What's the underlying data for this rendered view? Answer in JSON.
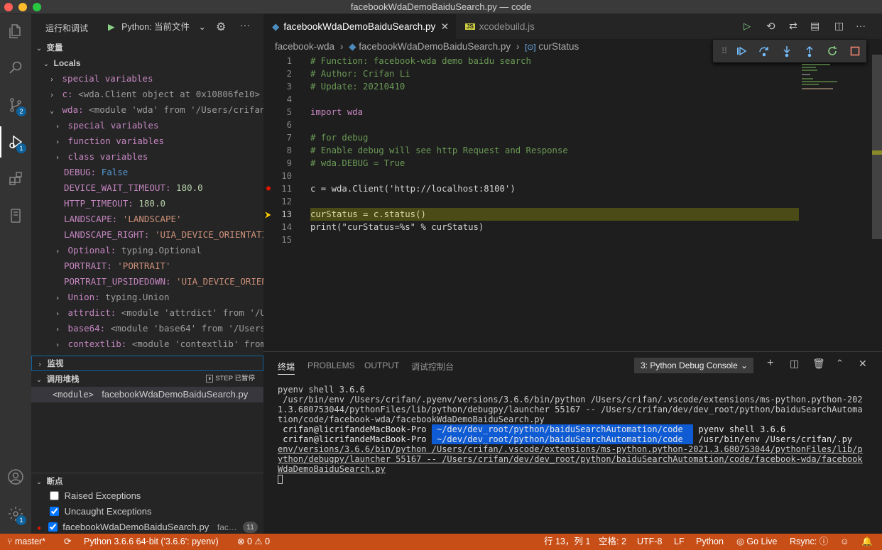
{
  "window": {
    "title": "facebookWdaDemoBaiduSearch.py — code"
  },
  "activity_bar": {
    "scm_badge": "2",
    "debug_badge": "1",
    "settings_badge": "1"
  },
  "sidebar": {
    "title": "运行和调试",
    "config": "Python: 当前文件",
    "sections": {
      "variables": "变量",
      "watch": "监视",
      "callstack": "调用堆栈",
      "breakpoints": "断点"
    },
    "locals_label": "Locals",
    "variables": [
      {
        "name": "special variables",
        "value": ""
      },
      {
        "name": "c:",
        "value": "<wda.Client object at 0x10806fe10>"
      },
      {
        "name": "wda:",
        "value": "<module 'wda' from '/Users/crifan/.py…"
      },
      {
        "name": "special variables",
        "value": ""
      },
      {
        "name": "function variables",
        "value": ""
      },
      {
        "name": "class variables",
        "value": ""
      },
      {
        "name": "DEBUG:",
        "value": "False"
      },
      {
        "name": "DEVICE_WAIT_TIMEOUT:",
        "value": "180.0"
      },
      {
        "name": "HTTP_TIMEOUT:",
        "value": "180.0"
      },
      {
        "name": "LANDSCAPE:",
        "value": "'LANDSCAPE'"
      },
      {
        "name": "LANDSCAPE_RIGHT:",
        "value": "'UIA_DEVICE_ORIENTATION_…"
      },
      {
        "name": "Optional:",
        "value": "typing.Optional"
      },
      {
        "name": "PORTRAIT:",
        "value": "'PORTRAIT'"
      },
      {
        "name": "PORTRAIT_UPSIDEDOWN:",
        "value": "'UIA_DEVICE_ORIENTAT…"
      },
      {
        "name": "Union:",
        "value": "typing.Union"
      },
      {
        "name": "attrdict:",
        "value": "<module 'attrdict' from '/Users…"
      },
      {
        "name": "base64:",
        "value": "<module 'base64' from '/Users/cri…"
      },
      {
        "name": "contextlib:",
        "value": "<module 'contextlib' from '/U…"
      }
    ],
    "callstack_status": "STEP 已暂停",
    "frame": {
      "name": "<module>",
      "file": "facebookWdaDemoBaiduSearch.py"
    },
    "breakpoints": [
      {
        "label": "Raised Exceptions"
      },
      {
        "label": "Uncaught Exceptions"
      },
      {
        "label": "facebookWdaDemoBaiduSearch.py",
        "dir": "fac…",
        "line": "11"
      }
    ]
  },
  "editor": {
    "tabs": [
      {
        "label": "facebookWdaDemoBaiduSearch.py"
      },
      {
        "label": "xcodebuild.js"
      }
    ],
    "breadcrumb": [
      "facebook-wda",
      "facebookWdaDemoBaiduSearch.py",
      "curStatus"
    ],
    "lines": [
      {
        "n": "1",
        "t": "# Function: facebook-wda demo baidu search"
      },
      {
        "n": "2",
        "t": "# Author: Crifan Li"
      },
      {
        "n": "3",
        "t": "# Update: 20210410"
      },
      {
        "n": "4",
        "t": ""
      },
      {
        "n": "5",
        "t": "import wda"
      },
      {
        "n": "6",
        "t": ""
      },
      {
        "n": "7",
        "t": "# for debug"
      },
      {
        "n": "8",
        "t": "# Enable debug will see http Request and Response"
      },
      {
        "n": "9",
        "t": "# wda.DEBUG = True"
      },
      {
        "n": "10",
        "t": ""
      },
      {
        "n": "11",
        "t": "c = wda.Client('http://localhost:8100')"
      },
      {
        "n": "12",
        "t": ""
      },
      {
        "n": "13",
        "t": "curStatus = c.status()"
      },
      {
        "n": "14",
        "t": "print(\"curStatus=%s\" % curStatus)"
      },
      {
        "n": "15",
        "t": ""
      }
    ]
  },
  "panel": {
    "tabs": [
      "终端",
      "PROBLEMS",
      "OUTPUT",
      "调试控制台"
    ],
    "terminal_select": "3: Python Debug Console",
    "terminal_lines": [
      "pyenv shell 3.6.6",
      " /usr/bin/env /Users/crifan/.pyenv/versions/3.6.6/bin/python /Users/crifan/.vscode/extensions/ms-python.python-202",
      "1.3.680753044/pythonFiles/lib/python/debugpy/launcher 55167 -- /Users/crifan/dev/dev_root/python/baiduSearchAutoma",
      "tion/code/facebook-wda/facebookWdaDemoBaiduSearch.py",
      " crifan@licrifandeMacBook-Pro  ~/dev/dev_root/python/baiduSearchAutomation/code   pyenv shell 3.6.6",
      " crifan@licrifandeMacBook-Pro  ~/dev/dev_root/python/baiduSearchAutomation/code   /usr/bin/env /Users/crifan/.py",
      "env/versions/3.6.6/bin/python /Users/crifan/.vscode/extensions/ms-python.python-2021.3.680753044/pythonFiles/lib/p",
      "ython/debugpy/launcher 55167 -- /Users/crifan/dev/dev_root/python/baiduSearchAutomation/code/facebook-wda/facebook",
      "WdaDemoBaiduSearch.py"
    ]
  },
  "statusbar": {
    "branch": "master*",
    "interpreter": "Python 3.6.6 64-bit ('3.6.6': pyenv)",
    "errors": "0",
    "warnings": "0",
    "position": "行 13，列 1",
    "spaces": "空格: 2",
    "encoding": "UTF-8",
    "eol": "LF",
    "language": "Python",
    "golive": "Go Live",
    "rsync": "Rsync:"
  },
  "colors": {
    "statusbar": "#c74e17",
    "accent": "#0e639c",
    "current_line": "#4b4b18"
  }
}
